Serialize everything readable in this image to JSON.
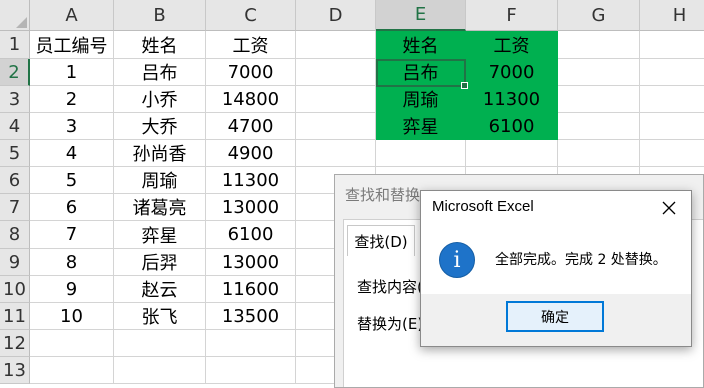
{
  "sheet": {
    "columns": [
      "A",
      "B",
      "C",
      "D",
      "E",
      "F",
      "G",
      "H"
    ],
    "rows": [
      "1",
      "2",
      "3",
      "4",
      "5",
      "6",
      "7",
      "8",
      "9",
      "10",
      "11",
      "12",
      "13"
    ],
    "table_left": {
      "headers": [
        "员工编号",
        "姓名",
        "工资"
      ],
      "data": [
        [
          "1",
          "吕布",
          "7000"
        ],
        [
          "2",
          "小乔",
          "14800"
        ],
        [
          "3",
          "大乔",
          "4700"
        ],
        [
          "4",
          "孙尚香",
          "4900"
        ],
        [
          "5",
          "周瑜",
          "11300"
        ],
        [
          "6",
          "诸葛亮",
          "13000"
        ],
        [
          "7",
          "弈星",
          "6100"
        ],
        [
          "8",
          "后羿",
          "13000"
        ],
        [
          "9",
          "赵云",
          "11600"
        ],
        [
          "10",
          "张飞",
          "13500"
        ]
      ]
    },
    "table_right": {
      "headers": [
        "姓名",
        "工资"
      ],
      "data": [
        [
          "吕布",
          "7000"
        ],
        [
          "周瑜",
          "11300"
        ],
        [
          "弈星",
          "6100"
        ]
      ],
      "fill_color": "#00b050"
    },
    "selected_cell": "E2",
    "accent_color": "#217346"
  },
  "find_replace": {
    "title": "查找和替换",
    "tab_find": "查找(D)",
    "find_label": "查找内容(",
    "replace_label": "替换为(E):"
  },
  "message_box": {
    "title": "Microsoft Excel",
    "icon": "info-icon",
    "message": "全部完成。完成 2 处替换。",
    "ok_label": "确定",
    "close_icon": "close-icon"
  }
}
